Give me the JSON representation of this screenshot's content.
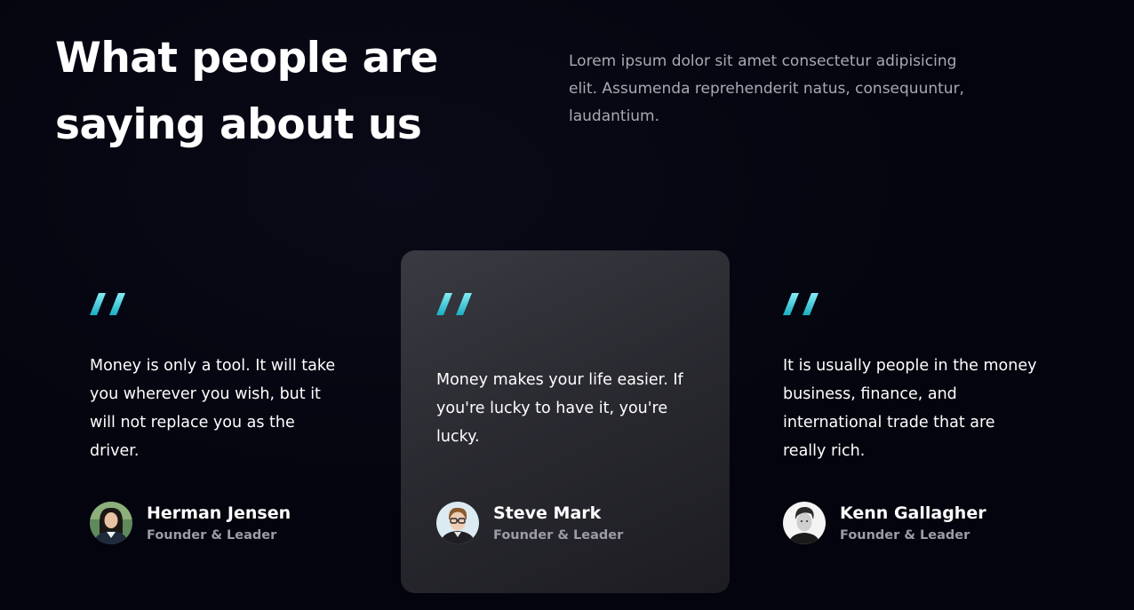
{
  "header": {
    "title": "What people are saying about us",
    "intro": "Lorem ipsum dolor sit amet consectetur adipisicing elit. Assumenda reprehenderit natus, consequuntur, laudantium."
  },
  "colors": {
    "accent_quote_top": "#7fe6f0",
    "accent_quote_bottom": "#1bb3c6",
    "featured_card_bg": "#2c2c33",
    "page_bg": "#04040e"
  },
  "testimonials": [
    {
      "quote": "Money is only a tool. It will take you wherever you wish, but it will not replace you as the driver.",
      "name": "Herman Jensen",
      "role": "Founder & Leader",
      "avatar_icon": "person-avatar-icon",
      "featured": false
    },
    {
      "quote": "Money makes your life easier. If you're lucky to have it, you're lucky.",
      "name": "Steve Mark",
      "role": "Founder & Leader",
      "avatar_icon": "person-avatar-icon",
      "featured": true
    },
    {
      "quote": "It is usually people in the money business, finance, and international trade that are really rich.",
      "name": "Kenn Gallagher",
      "role": "Founder & Leader",
      "avatar_icon": "person-avatar-icon",
      "featured": false
    }
  ]
}
